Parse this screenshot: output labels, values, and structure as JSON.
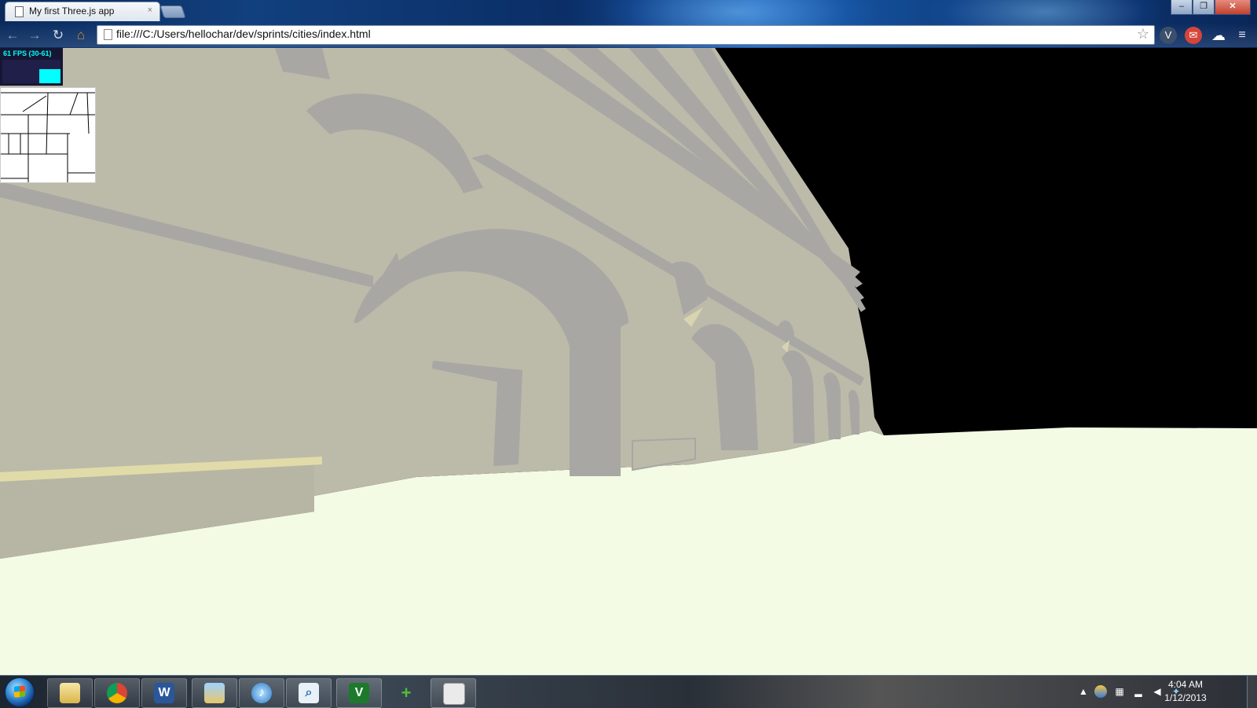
{
  "browser": {
    "tab": {
      "title": "My first Three.js app",
      "close_glyph": "×"
    },
    "window_controls": {
      "minimize": "–",
      "restore": "❐",
      "close": "✕"
    },
    "nav": {
      "back": "←",
      "forward": "→",
      "reload": "↻",
      "home": "⌂"
    },
    "address_bar": {
      "url": "file:///C:/Users/hellochar/dev/sprints/cities/index.html"
    },
    "extensions": [
      "vimium-icon",
      "gmail-checker-icon",
      "cloud-icon",
      "menu-icon"
    ]
  },
  "scene": {
    "stats": {
      "text": "61 FPS (30-61)",
      "fps_fraction": 0.6
    },
    "colors": {
      "sky": "#000000",
      "ground": "#f3fbe5",
      "wall": "#bcbaa9",
      "shadow": "#a8a7a3",
      "accent_edge": "#e0dba8"
    }
  },
  "taskbar": {
    "pinned": [
      "explorer-icon",
      "chrome-icon",
      "word-icon",
      "windows-explorer-icon",
      "itunes-icon",
      "search-icon",
      "vim-icon",
      "git-icon",
      "app-icon"
    ],
    "clock": {
      "time": "4:04 AM",
      "date": "1/12/2013"
    }
  }
}
